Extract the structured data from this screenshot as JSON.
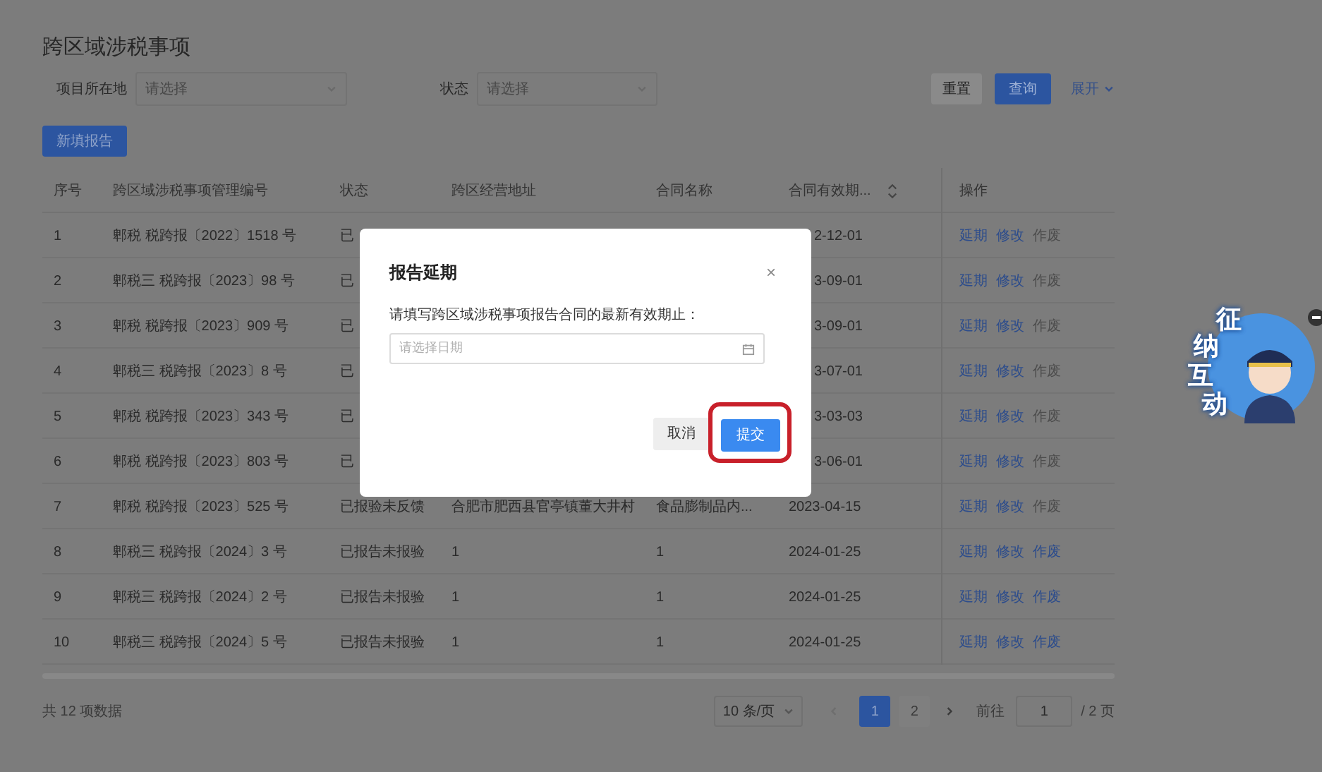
{
  "page_title": "跨区域涉税事项",
  "filters": [
    {
      "label": "项目所在地",
      "placeholder": "请选择"
    },
    {
      "label": "状态",
      "placeholder": "请选择"
    }
  ],
  "toolbar": {
    "reset": "重置",
    "query": "查询",
    "expand": "展开"
  },
  "new_button": "新填报告",
  "table": {
    "columns": [
      {
        "label": "序号"
      },
      {
        "label": "跨区域涉税事项管理编号"
      },
      {
        "label": "状态"
      },
      {
        "label": "跨区经营地址"
      },
      {
        "label": "合同名称"
      },
      {
        "label": "合同有效期...",
        "sortable": true
      },
      {
        "label": "操作"
      }
    ],
    "rows": [
      {
        "index": "1",
        "code": "郫税 税跨报〔2022〕1518 号",
        "status": "已",
        "expiry": "2-12-01",
        "under_dialog": true,
        "actions": [
          {
            "label": "延期",
            "disabled": false
          },
          {
            "label": "修改",
            "disabled": false
          },
          {
            "label": "作废",
            "disabled": true
          }
        ]
      },
      {
        "index": "2",
        "code": "郫税三 税跨报〔2023〕98 号",
        "status": "已",
        "expiry": "3-09-01",
        "under_dialog": true,
        "actions": [
          {
            "label": "延期",
            "disabled": false
          },
          {
            "label": "修改",
            "disabled": false
          },
          {
            "label": "作废",
            "disabled": true
          }
        ]
      },
      {
        "index": "3",
        "code": "郫税 税跨报〔2023〕909 号",
        "status": "已",
        "expiry": "3-09-01",
        "under_dialog": true,
        "actions": [
          {
            "label": "延期",
            "disabled": false
          },
          {
            "label": "修改",
            "disabled": false
          },
          {
            "label": "作废",
            "disabled": true
          }
        ]
      },
      {
        "index": "4",
        "code": "郫税三 税跨报〔2023〕8 号",
        "status": "已",
        "expiry": "3-07-01",
        "under_dialog": true,
        "actions": [
          {
            "label": "延期",
            "disabled": false
          },
          {
            "label": "修改",
            "disabled": false
          },
          {
            "label": "作废",
            "disabled": true
          }
        ]
      },
      {
        "index": "5",
        "code": "郫税 税跨报〔2023〕343 号",
        "status": "已",
        "expiry": "3-03-03",
        "under_dialog": true,
        "actions": [
          {
            "label": "延期",
            "disabled": false
          },
          {
            "label": "修改",
            "disabled": false
          },
          {
            "label": "作废",
            "disabled": true
          }
        ]
      },
      {
        "index": "6",
        "code": "郫税 税跨报〔2023〕803 号",
        "status": "已",
        "expiry": "3-06-01",
        "under_dialog": true,
        "actions": [
          {
            "label": "延期",
            "disabled": false
          },
          {
            "label": "修改",
            "disabled": false
          },
          {
            "label": "作废",
            "disabled": true
          }
        ]
      },
      {
        "index": "7",
        "code": "郫税 税跨报〔2023〕525 号",
        "status": "已报验未反馈",
        "address": "合肥市肥西县官亭镇董大井村",
        "contract": "食品膨制品内...",
        "expiry": "2023-04-15",
        "actions": [
          {
            "label": "延期",
            "disabled": false
          },
          {
            "label": "修改",
            "disabled": false
          },
          {
            "label": "作废",
            "disabled": true
          }
        ]
      },
      {
        "index": "8",
        "code": "郫税三 税跨报〔2024〕3 号",
        "status": "已报告未报验",
        "address": "1",
        "contract": "1",
        "expiry": "2024-01-25",
        "actions": [
          {
            "label": "延期",
            "disabled": false
          },
          {
            "label": "修改",
            "disabled": false
          },
          {
            "label": "作废",
            "disabled": false
          }
        ]
      },
      {
        "index": "9",
        "code": "郫税三 税跨报〔2024〕2 号",
        "status": "已报告未报验",
        "address": "1",
        "contract": "1",
        "expiry": "2024-01-25",
        "actions": [
          {
            "label": "延期",
            "disabled": false
          },
          {
            "label": "修改",
            "disabled": false
          },
          {
            "label": "作废",
            "disabled": false
          }
        ]
      },
      {
        "index": "10",
        "code": "郫税三 税跨报〔2024〕5 号",
        "status": "已报告未报验",
        "address": "1",
        "contract": "1",
        "expiry": "2024-01-25",
        "actions": [
          {
            "label": "延期",
            "disabled": false
          },
          {
            "label": "修改",
            "disabled": false
          },
          {
            "label": "作废",
            "disabled": false
          }
        ]
      }
    ]
  },
  "footer": {
    "total": "共 12 项数据",
    "page_size": "10 条/页",
    "pages": [
      {
        "label": "1",
        "selected": true
      },
      {
        "label": "2",
        "selected": false
      }
    ],
    "goto_label": "前往",
    "goto_value": "1",
    "page_count": "/ 2 页"
  },
  "dialog": {
    "title": "报告延期",
    "close": "×",
    "prompt": "请填写跨区域涉税事项报告合同的最新有效期止：",
    "placeholder": "请选择日期",
    "cancel": "取消",
    "submit": "提交",
    "submit_highlighted": true
  },
  "mascot": {
    "text": [
      "征",
      "纳",
      "互",
      "动"
    ]
  }
}
